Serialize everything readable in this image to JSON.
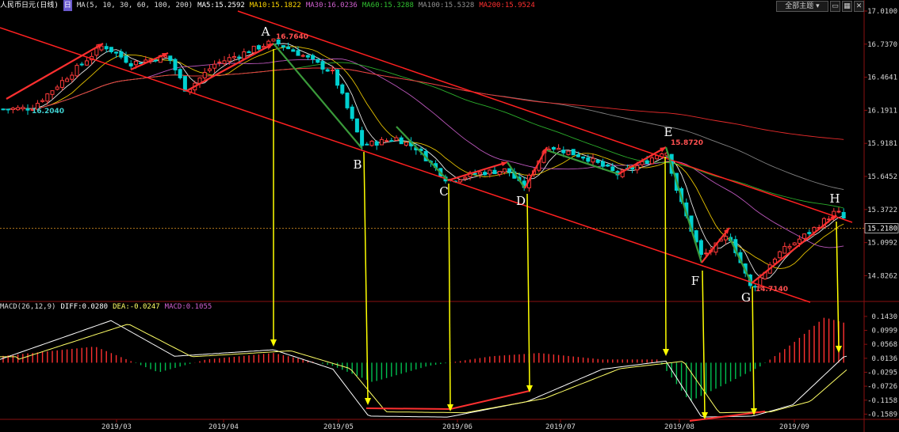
{
  "header": {
    "title": "人民币日元(日线)",
    "ma_label": "MA(5, 10, 30, 60, 100, 200)",
    "ma_values": [
      {
        "name": "MA5",
        "value": "15.2592",
        "color": "#ffffff"
      },
      {
        "name": "MA10",
        "value": "15.1822",
        "color": "#ffd700"
      },
      {
        "name": "MA30",
        "value": "16.0236",
        "color": "#d060d0"
      },
      {
        "name": "MA60",
        "value": "15.3288",
        "color": "#30c030"
      },
      {
        "name": "MA100",
        "value": "15.5328",
        "color": "#909090"
      },
      {
        "name": "MA200",
        "value": "15.9524",
        "color": "#ff3030"
      }
    ],
    "period_badge": "日"
  },
  "toolbar": {
    "theme_label": "全部主题",
    "theme_icon": "chevron-down-icon"
  },
  "macd_header": {
    "label": "MACD(26,12,9)",
    "diff": "DIFF:0.0280",
    "dea": "DEA:-0.0247",
    "macd": "MACD:0.1055"
  },
  "chart_data": [
    {
      "type": "candlestick",
      "title": "人民币日元(日线)",
      "price_axis_ticks": [
        "17.0100",
        "16.7370",
        "16.4641",
        "16.1911",
        "15.9181",
        "15.6452",
        "15.3722",
        "15.0992",
        "14.8262"
      ],
      "price_range": [
        14.62,
        17.01
      ],
      "current_price": "15.2180",
      "x_ticks": [
        "2019/03",
        "2019/04",
        "2019/05",
        "2019/06",
        "2019/07",
        "2019/08",
        "2019/09"
      ],
      "points": [
        {
          "label": "A",
          "price": "16.7640"
        },
        {
          "label": "B"
        },
        {
          "label": "C"
        },
        {
          "label": "D"
        },
        {
          "label": "E",
          "price": "15.8720"
        },
        {
          "label": "F"
        },
        {
          "label": "G",
          "price": "14.7140"
        },
        {
          "label": "H"
        }
      ],
      "low_annotation": "16.2040",
      "colors": {
        "up": "#ff3a3a",
        "down": "#00d0d0",
        "trend": "#ff2020",
        "swing_up": "#ff3030",
        "swing_down": "#3a9a3a",
        "projection": "#ffff00"
      }
    },
    {
      "type": "bar",
      "title": "MACD(26,12,9)",
      "axis_ticks": [
        "0.1430",
        "0.0999",
        "0.0568",
        "0.0136",
        "-0.0295",
        "-0.0726",
        "-0.1158",
        "-0.1589"
      ],
      "range": [
        -0.175,
        0.155
      ],
      "colors": {
        "diff": "#ffffff",
        "dea": "#ffff66",
        "positive": "#ff3030",
        "negative": "#00c050"
      }
    }
  ]
}
